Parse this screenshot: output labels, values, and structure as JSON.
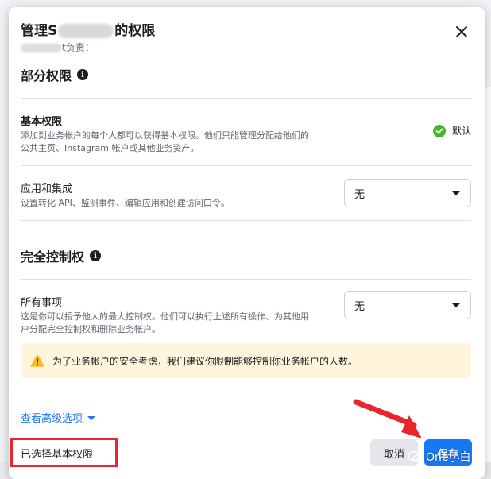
{
  "dialog": {
    "title_prefix": "管理S",
    "title_suffix": "的权限",
    "subtitle_suffix": "t负责："
  },
  "partial": {
    "heading": "部分权限",
    "basic": {
      "title": "基本权限",
      "desc_line1": "添加到业务帐户的每个人都可以获得基本权限。他们只能管理分配给他们的",
      "desc_line2": "公共主页、Instagram 帐户或其他业务资产。",
      "default_label": "默认"
    },
    "apps": {
      "title": "应用和集成",
      "desc": "设置转化 API、监测事件、编辑应用和创建访问口令。",
      "select_value": "无"
    }
  },
  "full": {
    "heading": "完全控制权",
    "all": {
      "title": "所有事项",
      "desc_line1": "这是你可以授予他人的最大控制权。他们可以执行上述所有操作、为其他用",
      "desc_line2": "户分配完全控制权和删除业务帐户。",
      "select_value": "无"
    },
    "warning": "为了业务帐户的安全考虑，我们建议你限制能够控制你业务帐户的人数。"
  },
  "advanced_label": "查看高级选项",
  "footer": {
    "selected_note": "已选择基本权限",
    "cancel_label": "取消",
    "save_label": "保存"
  },
  "watermark": "One小白",
  "colors": {
    "accent": "#1877f2",
    "success": "#42b72a",
    "warning_bg": "#fff5dc",
    "annotation_red": "#e8262b"
  }
}
